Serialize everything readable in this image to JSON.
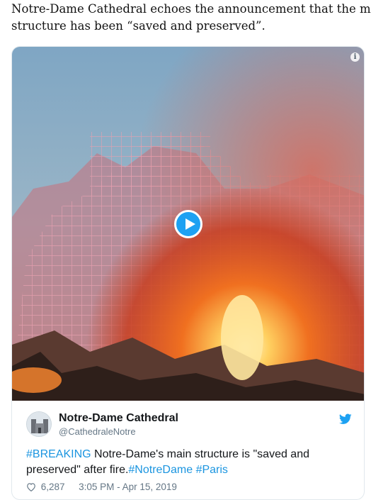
{
  "article": {
    "caption_line1": "Notre-Dame Cathedral echoes the announcement that the main",
    "caption_line2": "structure has been “saved and preserved”."
  },
  "tweet": {
    "author_name": "Notre-Dame Cathedral",
    "author_handle": "@CathedraleNotre",
    "text_hashtag_breaking": "#BREAKING",
    "text_line1_body": " Notre-Dame's main structure is \"saved and",
    "text_line2_body": "preserved\" after fire.",
    "text_hashtag_notredame": "#NotreDame",
    "text_hashtag_paris": "#Paris",
    "likes": "6,287",
    "time": "3:05 PM - Apr 15, 2019"
  },
  "media": {
    "info_glyph": "i",
    "play_icon": "play-icon"
  },
  "colors": {
    "twitter_blue": "#1da1f2",
    "link_blue": "#1b95e0",
    "muted_gray": "#657786"
  }
}
